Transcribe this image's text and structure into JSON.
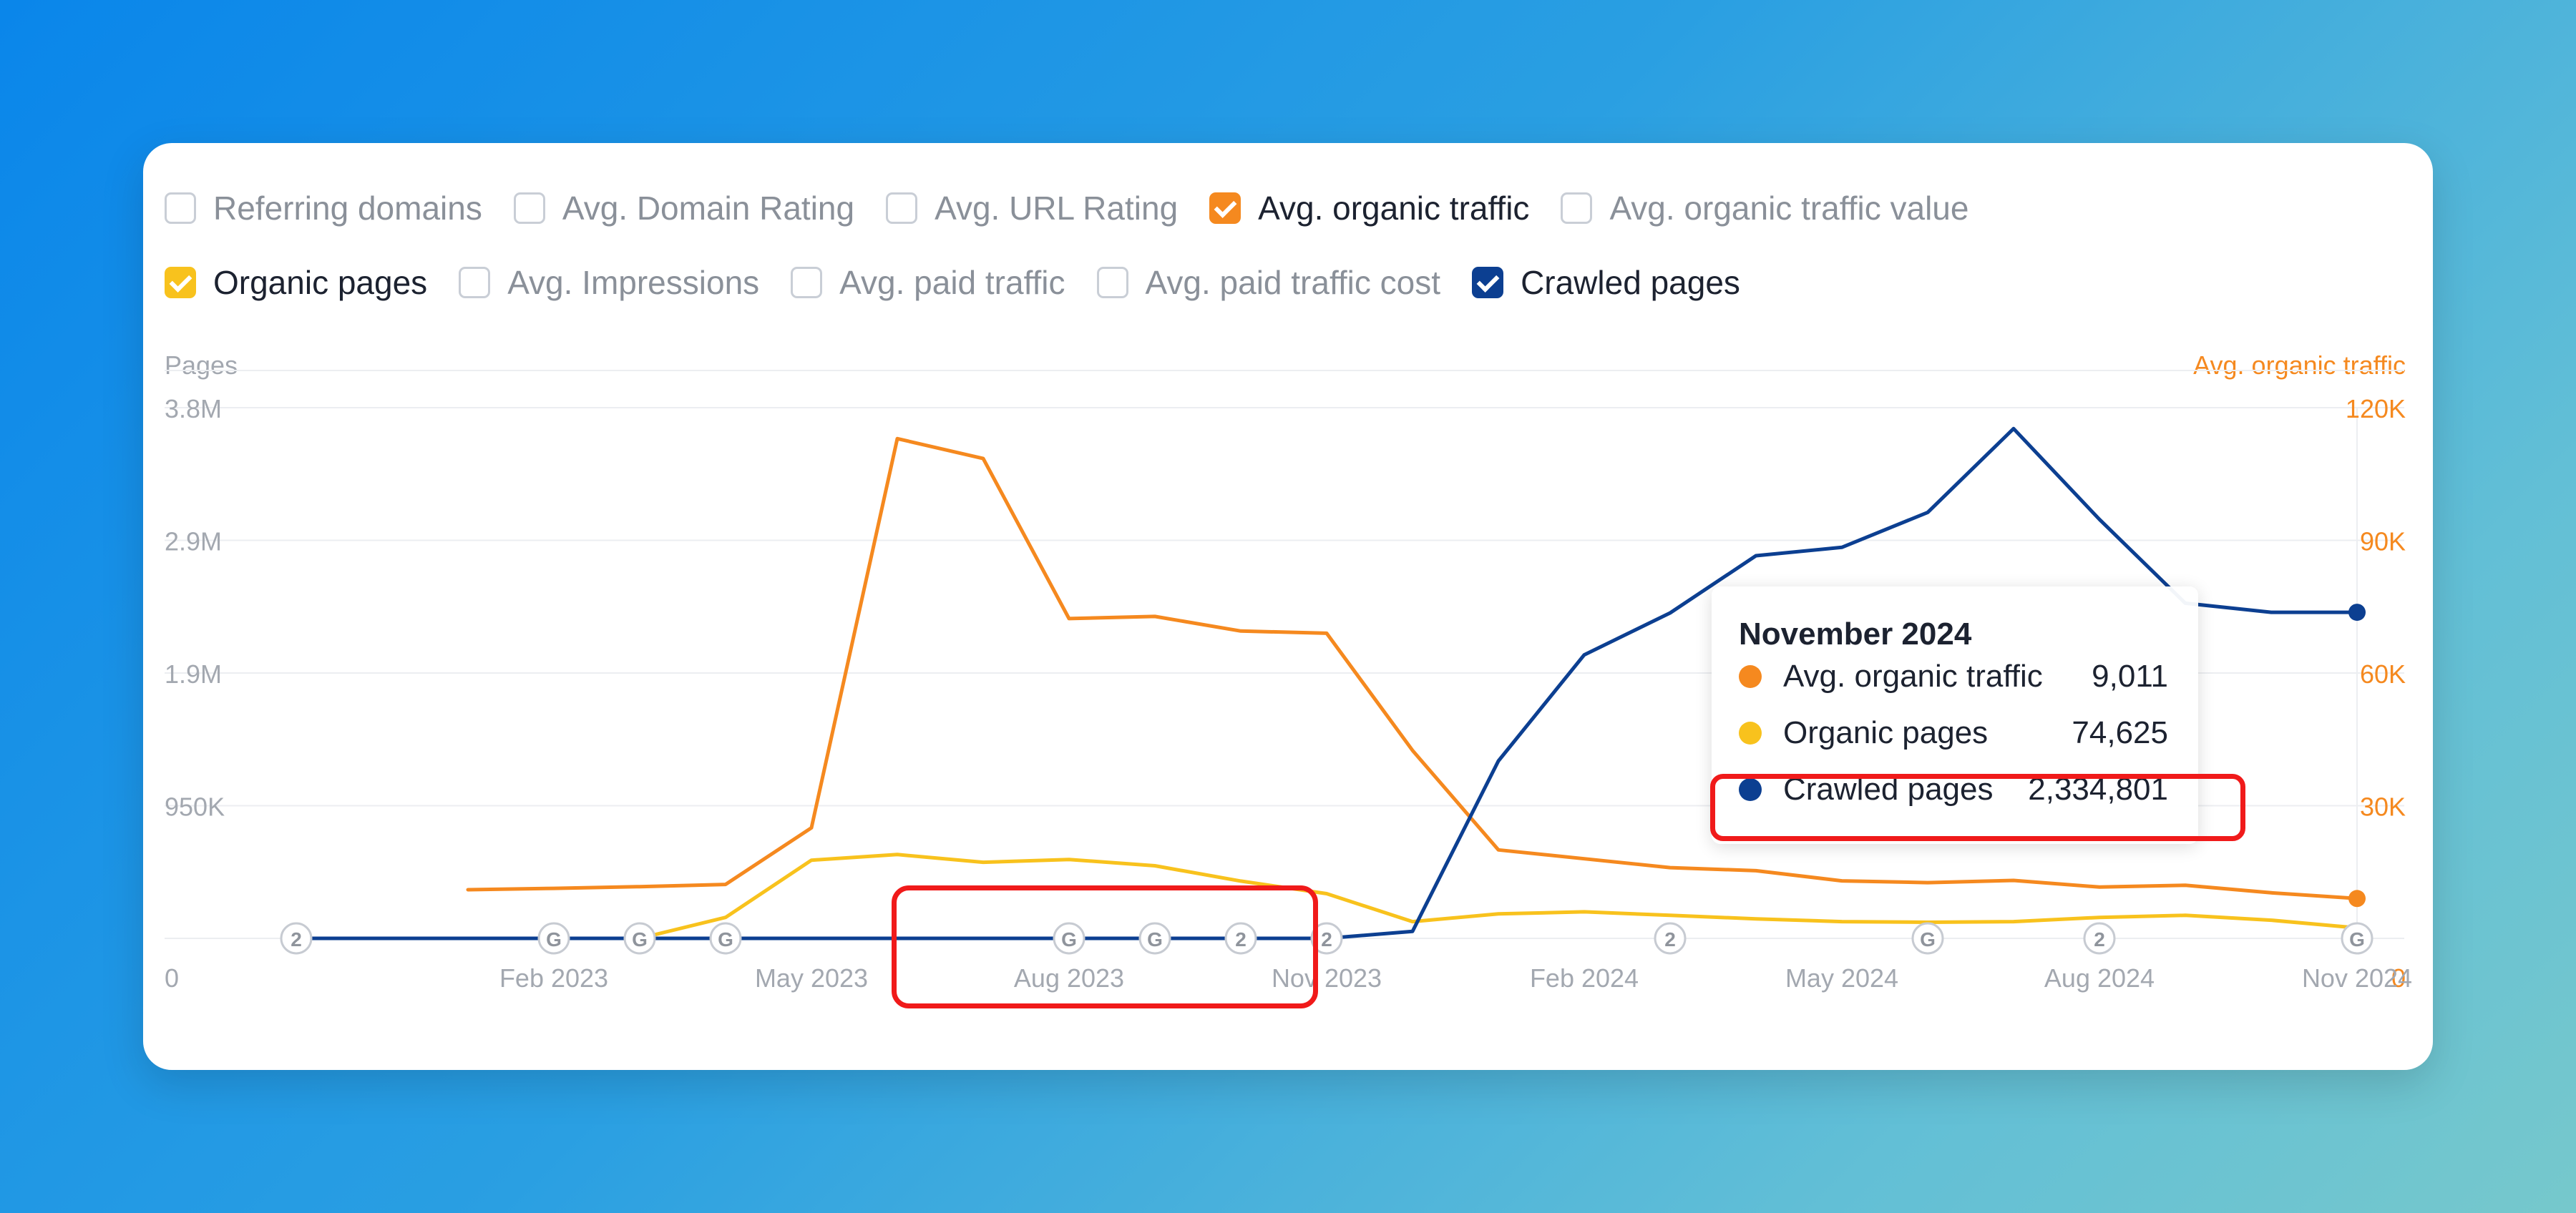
{
  "legend": {
    "row1": [
      {
        "label": "Referring domains",
        "checked": false,
        "color": ""
      },
      {
        "label": "Avg. Domain Rating",
        "checked": false,
        "color": ""
      },
      {
        "label": "Avg. URL Rating",
        "checked": false,
        "color": ""
      },
      {
        "label": "Avg. organic traffic",
        "checked": true,
        "color": "#f5891f"
      },
      {
        "label": "Avg. organic traffic value",
        "checked": false,
        "color": ""
      }
    ],
    "row2": [
      {
        "label": "Organic pages",
        "checked": true,
        "color": "#f8c21d"
      },
      {
        "label": "Avg. Impressions",
        "checked": false,
        "color": ""
      },
      {
        "label": "Avg. paid traffic",
        "checked": false,
        "color": ""
      },
      {
        "label": "Avg. paid traffic cost",
        "checked": false,
        "color": ""
      },
      {
        "label": "Crawled pages",
        "checked": true,
        "color": "#0c3f91"
      }
    ]
  },
  "tooltip": {
    "title": "November 2024",
    "rows": [
      {
        "label": "Avg. organic traffic",
        "value": "9,011",
        "color": "#f5891f"
      },
      {
        "label": "Organic pages",
        "value": "74,625",
        "color": "#f8c21d"
      },
      {
        "label": "Crawled pages",
        "value": "2,334,801",
        "color": "#0c3f91"
      }
    ]
  },
  "chart_data": {
    "type": "line",
    "left_axis_title": "Pages",
    "right_axis_title": "Avg. organic traffic",
    "left_ticks": [
      "0",
      "950K",
      "1.9M",
      "2.9M",
      "3.8M"
    ],
    "left_tick_values": [
      0,
      950000,
      1900000,
      2850000,
      3800000
    ],
    "right_ticks": [
      "0",
      "30K",
      "60K",
      "90K",
      "120K"
    ],
    "right_tick_values": [
      0,
      30000,
      60000,
      90000,
      120000
    ],
    "ylim_left": [
      0,
      3800000
    ],
    "ylim_right": [
      0,
      120000
    ],
    "x": [
      "2022-11",
      "2022-12",
      "2023-01",
      "2023-02",
      "2023-03",
      "2023-04",
      "2023-05",
      "2023-06",
      "2023-07",
      "2023-08",
      "2023-09",
      "2023-10",
      "2023-11",
      "2023-12",
      "2024-01",
      "2024-02",
      "2024-03",
      "2024-04",
      "2024-05",
      "2024-06",
      "2024-07",
      "2024-08",
      "2024-09",
      "2024-10",
      "2024-11"
    ],
    "x_tick_labels": [
      {
        "x": "2023-02",
        "label": "Feb 2023"
      },
      {
        "x": "2023-05",
        "label": "May 2023"
      },
      {
        "x": "2023-08",
        "label": "Aug 2023"
      },
      {
        "x": "2023-11",
        "label": "Nov 2023"
      },
      {
        "x": "2024-02",
        "label": "Feb 2024"
      },
      {
        "x": "2024-05",
        "label": "May 2024"
      },
      {
        "x": "2024-08",
        "label": "Aug 2024"
      },
      {
        "x": "2024-11",
        "label": "Nov 2024"
      }
    ],
    "series": [
      {
        "name": "Avg. organic traffic",
        "axis": "right",
        "color": "#f5891f",
        "values": [
          11000,
          11300,
          11700,
          12200,
          25000,
          113000,
          108500,
          72300,
          72800,
          69500,
          69000,
          42500,
          20000,
          18000,
          16000,
          15300,
          13000,
          12600,
          13100,
          11600,
          12000,
          10300,
          9011
        ]
      },
      {
        "name": "Organic pages",
        "axis": "left",
        "color": "#f8c21d",
        "values": [
          null,
          null,
          null,
          null,
          0,
          150000,
          560000,
          600000,
          545000,
          565000,
          520000,
          410000,
          320000,
          120000,
          175000,
          190000,
          165000,
          140000,
          120000,
          115000,
          120000,
          150000,
          165000,
          130000,
          74625
        ]
      },
      {
        "name": "Crawled pages",
        "axis": "left",
        "color": "#0c3f91",
        "values": [
          0,
          0,
          0,
          0,
          0,
          0,
          0,
          0,
          0,
          0,
          0,
          0,
          0,
          50000,
          1270000,
          2030000,
          2330000,
          2740000,
          2800000,
          3050000,
          3650000,
          3000000,
          2400000,
          2334801,
          2334801
        ]
      }
    ],
    "markers": [
      {
        "x": "2022-11",
        "label": "2"
      },
      {
        "x": "2023-02",
        "label": "G"
      },
      {
        "x": "2023-03",
        "label": "G"
      },
      {
        "x": "2023-04",
        "label": "G"
      },
      {
        "x": "2023-08",
        "label": "G"
      },
      {
        "x": "2023-09",
        "label": "G"
      },
      {
        "x": "2023-10",
        "label": "2"
      },
      {
        "x": "2023-11",
        "label": "2"
      },
      {
        "x": "2024-03",
        "label": "2"
      },
      {
        "x": "2024-06",
        "label": "G"
      },
      {
        "x": "2024-08",
        "label": "2"
      },
      {
        "x": "2024-11",
        "label": "G"
      }
    ],
    "grid": true,
    "hover_x": "2024-11"
  }
}
